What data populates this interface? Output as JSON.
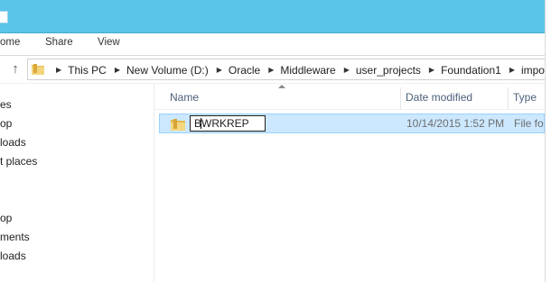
{
  "ribbon": {
    "tabs": [
      "ome",
      "Share",
      "View"
    ]
  },
  "address": {
    "crumbs": [
      "This PC",
      "New Volume (D:)",
      "Oracle",
      "Middleware",
      "user_projects",
      "Foundation1",
      "impor"
    ]
  },
  "nav": {
    "items": [
      "es",
      "op",
      "loads",
      "t places",
      "op",
      "ments",
      "loads"
    ]
  },
  "columns": {
    "name": "Name",
    "date_modified": "Date modified",
    "type": "Type"
  },
  "rows": [
    {
      "name": "BWRKREP",
      "date_modified": "10/14/2015 1:52 PM",
      "type": "File fo",
      "icon": "folder-icon"
    }
  ],
  "colors": {
    "titlebar": "#5ac4e9",
    "selection": "#cce8ff",
    "folder": "#e8c25a"
  }
}
